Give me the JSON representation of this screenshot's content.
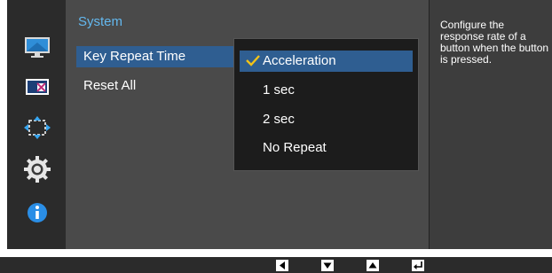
{
  "menu": {
    "title": "System",
    "items": [
      {
        "label": "Key Repeat Time"
      },
      {
        "label": "Reset All"
      }
    ]
  },
  "submenu": {
    "options": [
      {
        "label": "Acceleration",
        "selected": true
      },
      {
        "label": "1 sec"
      },
      {
        "label": "2 sec"
      },
      {
        "label": "No Repeat"
      }
    ]
  },
  "help": {
    "lines": [
      "Configure the",
      "response rate of a",
      "button when the button",
      "is pressed."
    ]
  },
  "sidebar_icons": [
    "picture-icon",
    "color-icon",
    "size-position-icon",
    "system-gear-icon",
    "information-icon"
  ],
  "nav_buttons": [
    "left-arrow-icon",
    "down-arrow-icon",
    "up-arrow-icon",
    "enter-icon"
  ],
  "colors": {
    "accent": "#63b8ef",
    "selection": "#2f5e91",
    "check": "#f2c318"
  }
}
